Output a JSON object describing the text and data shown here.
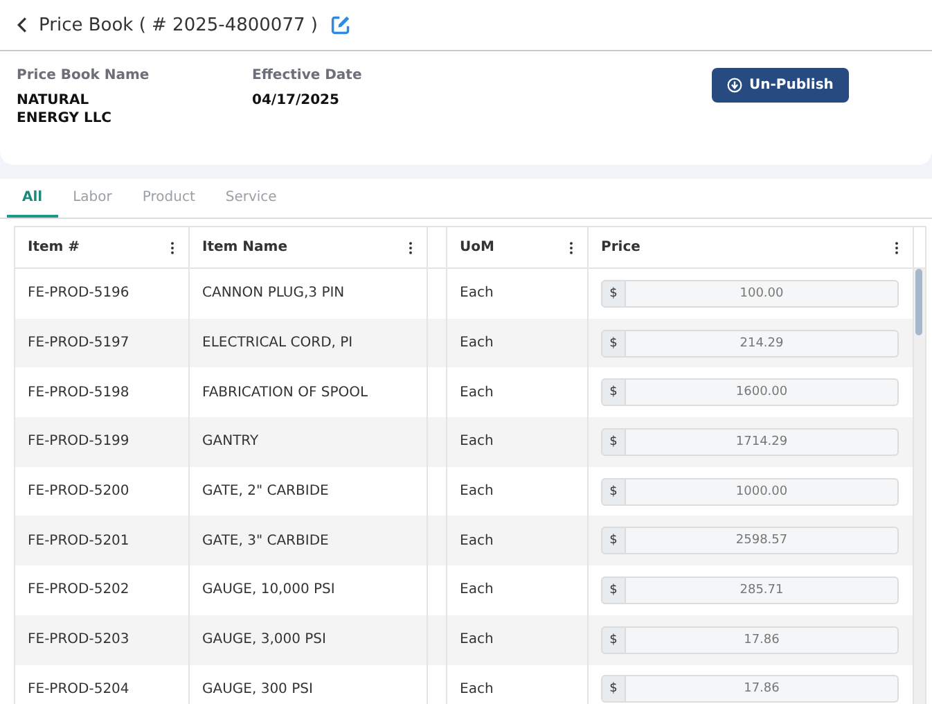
{
  "header": {
    "title": "Price Book ( # 2025-4800077 )"
  },
  "details": {
    "fields": [
      {
        "label": "Price Book Name",
        "value": "NATURAL ENERGY LLC"
      },
      {
        "label": "Effective Date",
        "value": "04/17/2025"
      }
    ],
    "action": "Un-Publish"
  },
  "tabs": [
    {
      "label": "All",
      "selected": true
    },
    {
      "label": "Labor",
      "selected": false
    },
    {
      "label": "Product",
      "selected": false
    },
    {
      "label": "Service",
      "selected": false
    }
  ],
  "table": {
    "columns": [
      "Item #",
      "Item Name",
      "UoM",
      "Price"
    ],
    "rows": [
      {
        "item": "FE-PROD-5196",
        "name": "CANNON PLUG,3 PIN",
        "uom": "Each",
        "currency": "$",
        "price": "100.00"
      },
      {
        "item": "FE-PROD-5197",
        "name": "ELECTRICAL CORD, PI",
        "uom": "Each",
        "currency": "$",
        "price": "214.29"
      },
      {
        "item": "FE-PROD-5198",
        "name": "FABRICATION OF SPOOL",
        "uom": "Each",
        "currency": "$",
        "price": "1600.00"
      },
      {
        "item": "FE-PROD-5199",
        "name": "GANTRY",
        "uom": "Each",
        "currency": "$",
        "price": "1714.29"
      },
      {
        "item": "FE-PROD-5200",
        "name": "GATE, 2\" CARBIDE",
        "uom": "Each",
        "currency": "$",
        "price": "1000.00"
      },
      {
        "item": "FE-PROD-5201",
        "name": "GATE, 3\" CARBIDE",
        "uom": "Each",
        "currency": "$",
        "price": "2598.57"
      },
      {
        "item": "FE-PROD-5202",
        "name": "GAUGE, 10,000 PSI",
        "uom": "Each",
        "currency": "$",
        "price": "285.71"
      },
      {
        "item": "FE-PROD-5203",
        "name": "GAUGE, 3,000 PSI",
        "uom": "Each",
        "currency": "$",
        "price": "17.86"
      },
      {
        "item": "FE-PROD-5204",
        "name": "GAUGE, 300 PSI",
        "uom": "Each",
        "currency": "$",
        "price": "17.86"
      }
    ]
  }
}
